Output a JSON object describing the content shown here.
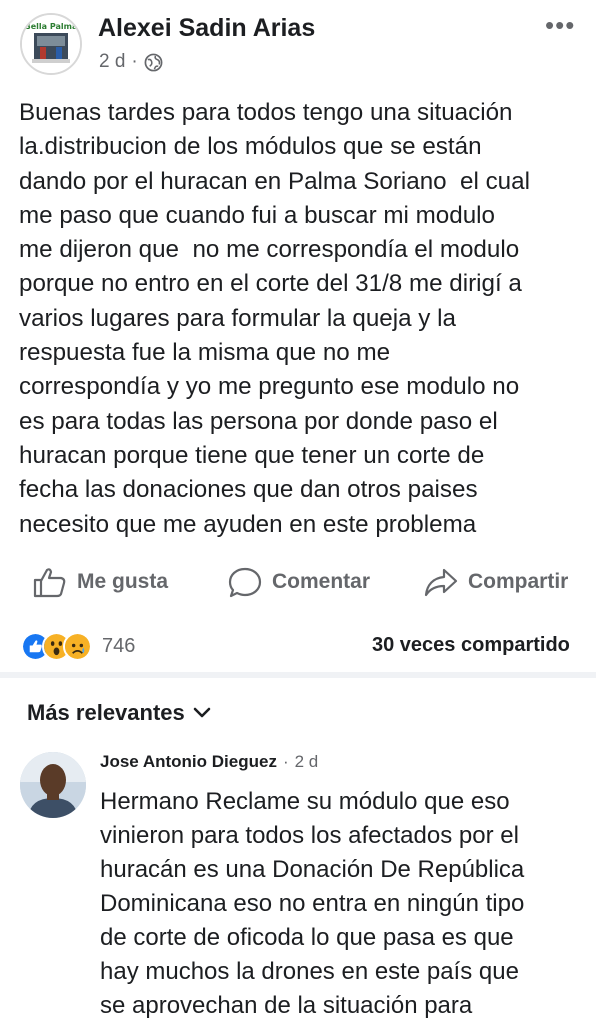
{
  "post": {
    "author": "Alexei Sadin Arias",
    "time": "2 d",
    "separator": "·",
    "audience_icon": "globe-icon",
    "more_label": "•••",
    "avatar_text": "Bella Palma",
    "body_lines": [
      "Buenas tardes para todos tengo una situación",
      "la.distribucion de los módulos que se están",
      "dando por el huracan en Palma Soriano  el cual",
      "me paso que cuando fui a buscar mi modulo",
      "me dijeron que  no me correspondía el modulo",
      "porque no entro en el corte del 31/8 me dirigí a",
      "varios lugares para formular la queja y la",
      "respuesta fue la misma que no me",
      "correspondía y yo me pregunto ese modulo no",
      "es para todas las persona por donde paso el",
      "huracan porque tiene que tener un corte de",
      "fecha las donaciones que dan otros paises",
      "necesito que me ayuden en este problema"
    ]
  },
  "actions": {
    "like_label": "Me gusta",
    "comment_label": "Comentar",
    "share_label": "Compartir"
  },
  "stats": {
    "reactions": [
      "like",
      "wow",
      "sad"
    ],
    "reaction_count": "746",
    "shares_text": "30 veces compartido"
  },
  "comments_section": {
    "sort_label": "Más relevantes"
  },
  "comment": {
    "author": "Jose Antonio Dieguez",
    "separator": "·",
    "time": "2 d",
    "body_lines": [
      "Hermano Reclame su módulo que eso",
      "vinieron para todos los afectados por el",
      "huracán es una Donación De República",
      "Dominicana eso no entra en ningún tipo",
      "de corte de oficoda lo que pasa es que",
      "hay muchos la drones en este país que",
      "se aprovechan de la situación para"
    ]
  },
  "colors": {
    "like_blue": "#1877f2",
    "reaction_yellow": "#f7b125",
    "secondary_text": "#65676b"
  }
}
